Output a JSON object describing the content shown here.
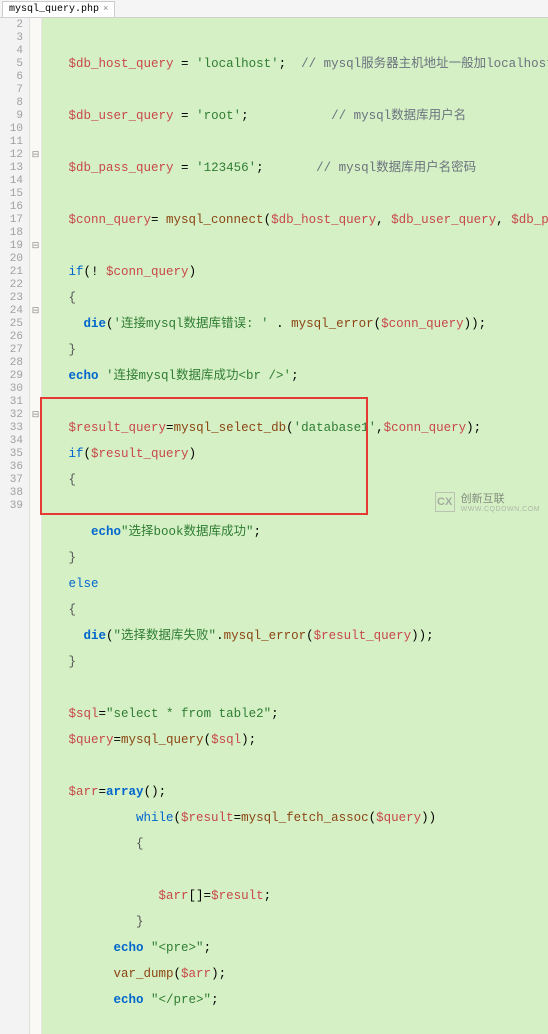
{
  "tab": {
    "label": "mysql_query.php",
    "close": "×"
  },
  "gutter": [
    "2",
    "3",
    "4",
    "5",
    "6",
    "7",
    "8",
    "9",
    "10",
    "11",
    "12",
    "13",
    "14",
    "15",
    "16",
    "17",
    "18",
    "19",
    "20",
    "21",
    "22",
    "23",
    "24",
    "25",
    "26",
    "27",
    "28",
    "29",
    "30",
    "31",
    "32",
    "33",
    "34",
    "35",
    "36",
    "37",
    "38",
    "39"
  ],
  "fold": [
    "",
    "",
    "",
    "",
    "",
    "",
    "",
    "",
    "",
    "",
    "⊟",
    "",
    "",
    "",
    "",
    "",
    "",
    "⊟",
    "",
    "",
    "",
    "",
    "⊟",
    "",
    "",
    "",
    "",
    "",
    "",
    "",
    "⊟",
    "",
    "",
    "",
    "",
    "",
    "",
    "",
    ""
  ],
  "code": {
    "l2": "",
    "l3_var": "$db_host_query",
    "l3_str": "'localhost'",
    "l3_cm": "// mysql服务器主机地址一般加localhost就可以",
    "l4": "",
    "l5_var": "$db_user_query",
    "l5_str": "'root'",
    "l5_cm": "// mysql数据库用户名",
    "l6": "",
    "l7_var": "$db_pass_query",
    "l7_str": "'123456'",
    "l7_cm": "// mysql数据库用户名密码",
    "l8": "",
    "l9_var": "$conn_query",
    "l9_fn": "mysql_connect",
    "l9_a1": "$db_host_query",
    "l9_a2": "$db_user_query",
    "l9_a3": "$db_pass_query",
    "l10": "",
    "l11_kw": "if",
    "l11_var": "$conn_query",
    "l12_br": "{",
    "l13_fn": "die",
    "l13_str": "'连接mysql数据库错误: '",
    "l13_fn2": "mysql_error",
    "l13_var": "$conn_query",
    "l14_br": "}",
    "l15_fn": "echo",
    "l15_str": "'连接mysql数据库成功<br />'",
    "l16": "",
    "l17_var": "$result_query",
    "l17_fn": "mysql_select_db",
    "l17_str": "'database1'",
    "l17_v2": "$conn_query",
    "l18_kw": "if",
    "l18_var": "$result_query",
    "l19_br": "{",
    "l20": "",
    "l21_fn": "echo",
    "l21_str": "\"选择book数据库成功\"",
    "l22_br": "}",
    "l23_kw": "else",
    "l24_br": "{",
    "l25_fn": "die",
    "l25_str": "\"选择数据库失败\"",
    "l25_fn2": "mysql_error",
    "l25_var": "$result_query",
    "l26_br": "}",
    "l27": "",
    "l28_var": "$sql",
    "l28_str": "\"select * from table2\"",
    "l29_var": "$query",
    "l29_fn": "mysql_query",
    "l29_v2": "$sql",
    "l30": "",
    "l31_var": "$arr",
    "l31_fn": "array",
    "l32_kw": "while",
    "l32_var": "$result",
    "l32_fn": "mysql_fetch_assoc",
    "l32_v2": "$query",
    "l33_br": "{",
    "l34": "",
    "l35_var": "$arr",
    "l35_v2": "$result",
    "l36_br": "}",
    "l37_fn": "echo",
    "l37_str": "\"<pre>\"",
    "l38_fn": "var_dump",
    "l38_var": "$arr",
    "l39_fn": "echo",
    "l39_str": "\"</pre>\""
  },
  "watermark": {
    "logo": "CX",
    "text": "创新互联",
    "sub": "WWW.CQDOWN.COM"
  }
}
